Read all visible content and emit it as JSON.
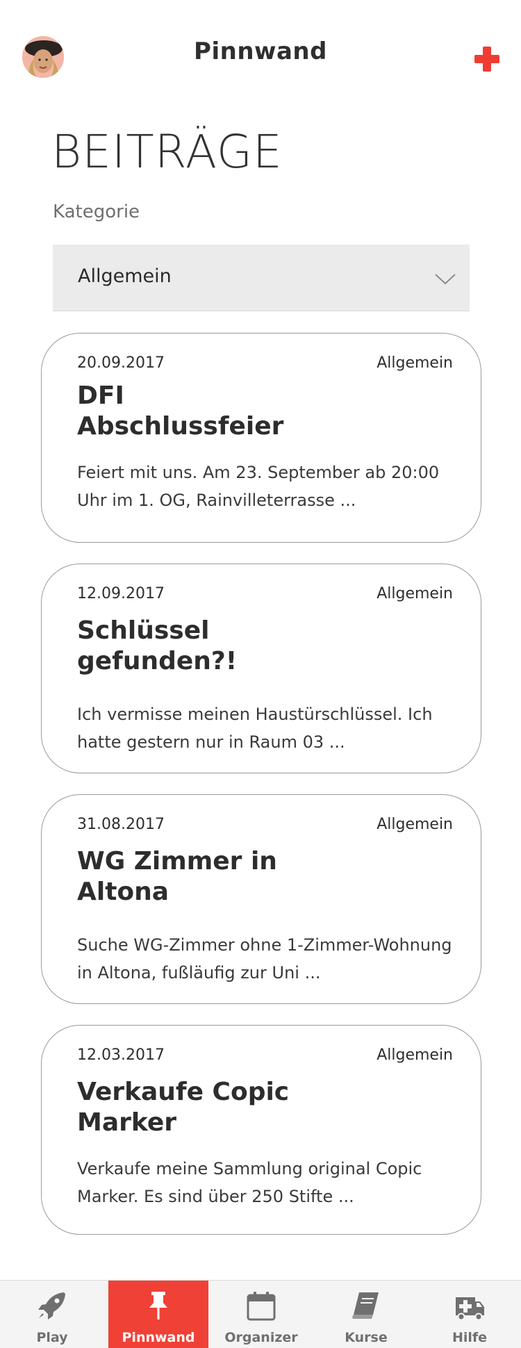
{
  "header": {
    "title": "Pinnwand",
    "avatar_icon": "user-avatar",
    "add_icon": "plus-icon",
    "accent_color": "#ef3c32"
  },
  "page": {
    "title": "BEITRÄGE",
    "category_label": "Kategorie",
    "category_value": "Allgemein"
  },
  "posts": [
    {
      "date": "20.09.2017",
      "category": "Allgemein",
      "title": "DFI Abschlussfeier",
      "excerpt": "Feiert mit uns. Am 23. September ab 20:00 Uhr im 1. OG, Rainvilleterrasse ..."
    },
    {
      "date": "12.09.2017",
      "category": "Allgemein",
      "title": "Schlüssel gefunden?!",
      "excerpt": "Ich vermisse meinen Haustürschlüssel. Ich hatte gestern nur in Raum 03 ..."
    },
    {
      "date": "31.08.2017",
      "category": "Allgemein",
      "title": "WG Zimmer in Altona",
      "excerpt": "Suche WG-Zimmer ohne 1-Zimmer-Wohnung in Altona, fußläufig zur Uni ..."
    },
    {
      "date": "12.03.2017",
      "category": "Allgemein",
      "title": "Verkaufe Copic Marker",
      "excerpt": "Verkaufe meine Sammlung original Copic Marker. Es sind über 250 Stifte ..."
    }
  ],
  "tabs": [
    {
      "label": "Play",
      "icon": "rocket-icon",
      "active": false
    },
    {
      "label": "Pinnwand",
      "icon": "pin-icon",
      "active": true
    },
    {
      "label": "Organizer",
      "icon": "calendar-icon",
      "active": false
    },
    {
      "label": "Kurse",
      "icon": "book-icon",
      "active": false
    },
    {
      "label": "Hilfe",
      "icon": "ambulance-icon",
      "active": false
    }
  ]
}
